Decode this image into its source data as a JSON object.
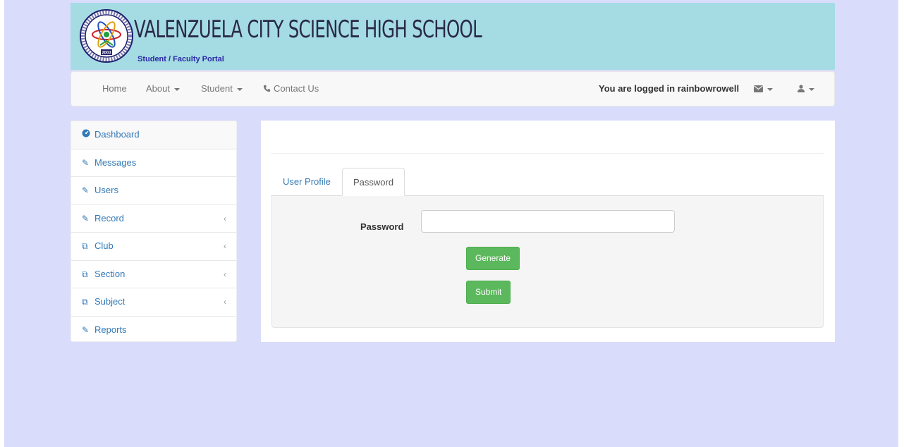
{
  "header": {
    "school_name": "VALENZUELA CITY SCIENCE HIGH SCHOOL",
    "portal_label": "Student / Faculty Portal",
    "seal_year": "2003"
  },
  "navbar": {
    "home": "Home",
    "about": "About",
    "student": "Student",
    "contact": "Contact Us",
    "logged_in_text": "You are logged in rainbowrowell",
    "messages_icon": "envelope-icon",
    "user_icon": "user-icon"
  },
  "sidebar": {
    "items": [
      {
        "label": "Dashboard",
        "icon": "tachometer-icon",
        "has_submenu": false
      },
      {
        "label": "Messages",
        "icon": "edit-icon",
        "has_submenu": false
      },
      {
        "label": "Users",
        "icon": "edit-icon",
        "has_submenu": false
      },
      {
        "label": "Record",
        "icon": "edit-icon",
        "has_submenu": true
      },
      {
        "label": "Club",
        "icon": "copy-icon",
        "has_submenu": true
      },
      {
        "label": "Section",
        "icon": "copy-icon",
        "has_submenu": true
      },
      {
        "label": "Subject",
        "icon": "copy-icon",
        "has_submenu": true
      },
      {
        "label": "Reports",
        "icon": "edit-icon",
        "has_submenu": false
      }
    ]
  },
  "main": {
    "tabs": [
      {
        "label": "User Profile",
        "active": false
      },
      {
        "label": "Password",
        "active": true
      }
    ],
    "form": {
      "password_label": "Password",
      "password_value": "",
      "generate_label": "Generate",
      "submit_label": "Submit"
    }
  },
  "colors": {
    "page_background": "#d9dcfb",
    "banner_background": "#a5dce4",
    "link": "#337ab7",
    "success_button": "#5cb85c"
  }
}
